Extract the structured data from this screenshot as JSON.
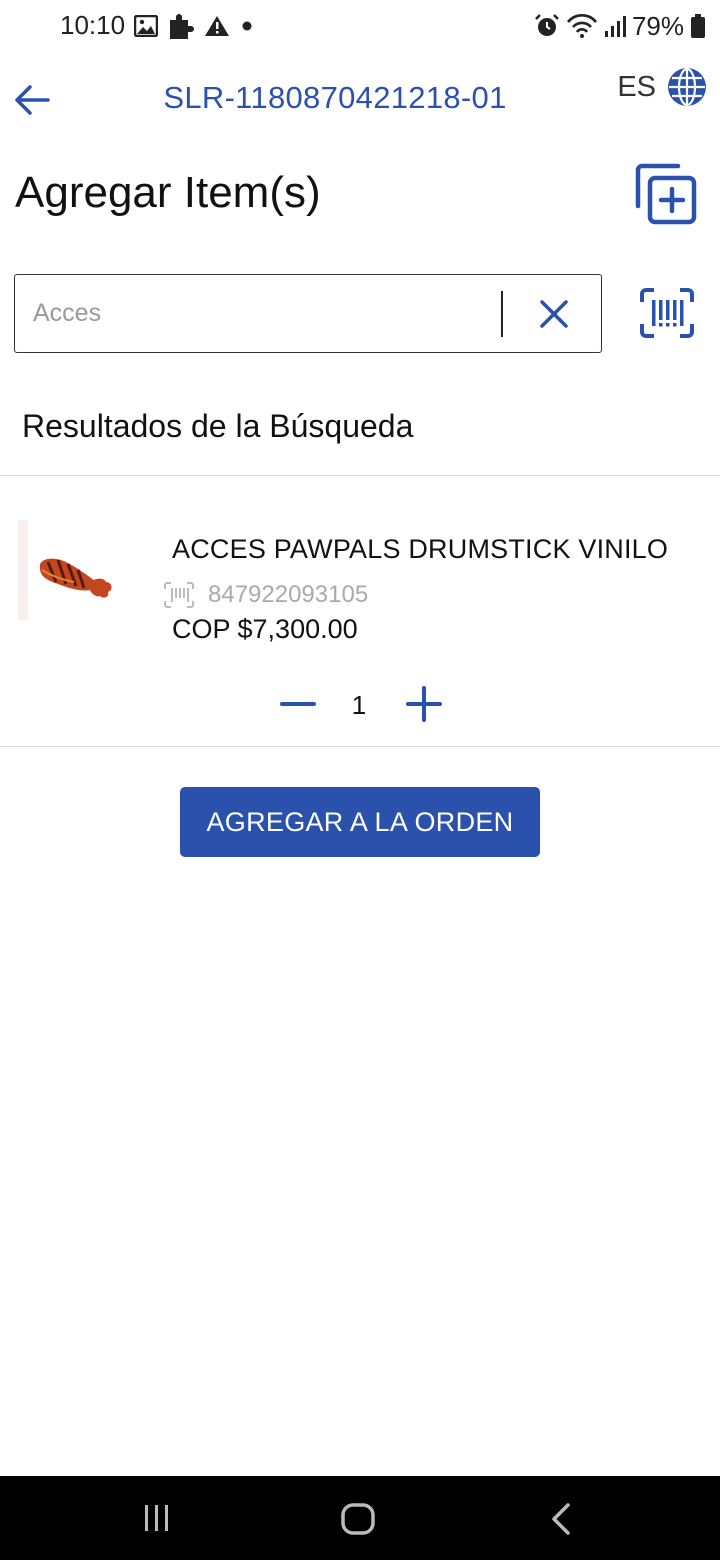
{
  "status_bar": {
    "time": "10:10",
    "battery": "79%",
    "left_icons": [
      "gallery-icon",
      "puzzle-icon",
      "warning-icon",
      "dot-icon"
    ],
    "right_icons": [
      "alarm-icon",
      "wifi-icon",
      "signal-icon",
      "battery-icon"
    ]
  },
  "header": {
    "order_id": "SLR-1180870421218-01",
    "language": "ES"
  },
  "page": {
    "title": "Agregar Item(s)"
  },
  "search": {
    "value": "",
    "placeholder": "Acces"
  },
  "results": {
    "heading": "Resultados de la Búsqueda",
    "items": [
      {
        "name": "ACCES PAWPALS DRUMSTICK VINILO",
        "barcode": "847922093105",
        "price": "COP $7,300.00",
        "quantity": "1"
      }
    ]
  },
  "actions": {
    "add_to_order": "AGREGAR A LA ORDEN"
  },
  "colors": {
    "accent": "#2a52ad",
    "text": "#111111",
    "muted": "#aaaaaa",
    "nav_bar": "#000000"
  }
}
